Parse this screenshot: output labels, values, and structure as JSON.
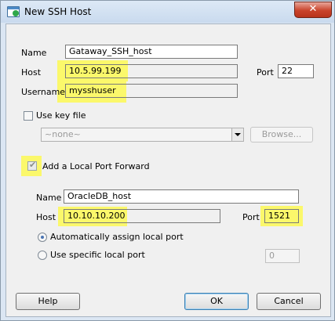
{
  "window": {
    "title": "New SSH Host",
    "close_label": "✕"
  },
  "ssh": {
    "name_label": "Name",
    "name_value": "Gataway_SSH_host",
    "host_label": "Host",
    "host_value": "10.5.99.199",
    "port_label": "Port",
    "port_value": "22",
    "username_label": "Username",
    "username_value": "mysshuser"
  },
  "key_file": {
    "label": "Use key file",
    "checked": false,
    "select_value": "~none~",
    "browse_label": "Browse..."
  },
  "forward": {
    "label": "Add a Local Port Forward",
    "checked": true,
    "name_label": "Name",
    "name_value": "OracleDB_host",
    "host_label": "Host",
    "host_value": "10.10.10.200",
    "port_label": "Port",
    "port_value": "1521"
  },
  "local_port": {
    "auto_label": "Automatically assign local port",
    "auto_selected": true,
    "specific_label": "Use specific local port",
    "specific_value": "0"
  },
  "buttons": {
    "help": "Help",
    "ok": "OK",
    "cancel": "Cancel"
  },
  "colors": {
    "highlight": "#fbf86b",
    "title_bar": "#c9daee",
    "close": "#c9432b",
    "panel": "#f0f0f0"
  }
}
